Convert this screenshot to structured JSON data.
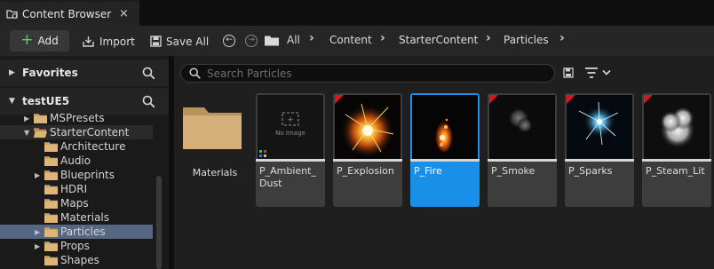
{
  "tab": {
    "title": "Content Browser",
    "close": "×"
  },
  "toolbar": {
    "add_label": "Add",
    "import_label": "Import",
    "saveall_label": "Save All",
    "breadcrumbs": [
      "All",
      "Content",
      "StarterContent",
      "Particles"
    ]
  },
  "sidebar": {
    "favorites_label": "Favorites",
    "project_label": "testUE5",
    "tree": [
      {
        "label": "MSPresets",
        "depth": 1,
        "expandable": true
      },
      {
        "label": "StarterContent",
        "depth": 1,
        "expanded": true
      },
      {
        "label": "Architecture",
        "depth": 2
      },
      {
        "label": "Audio",
        "depth": 2
      },
      {
        "label": "Blueprints",
        "depth": 2,
        "expandable": true
      },
      {
        "label": "HDRI",
        "depth": 2
      },
      {
        "label": "Maps",
        "depth": 2
      },
      {
        "label": "Materials",
        "depth": 2
      },
      {
        "label": "Particles",
        "depth": 2,
        "expandable": true,
        "selected": true
      },
      {
        "label": "Props",
        "depth": 2,
        "expandable": true
      },
      {
        "label": "Shapes",
        "depth": 2
      }
    ]
  },
  "search": {
    "placeholder": "Search Particles"
  },
  "assets": [
    {
      "label": "Materials",
      "type": "folder"
    },
    {
      "label": "P_Ambient_ Dust",
      "type": "noimage",
      "noimage_text": "No Image"
    },
    {
      "label": "P_Explosion",
      "type": "explosion"
    },
    {
      "label": "P_Fire",
      "type": "fire",
      "selected": true
    },
    {
      "label": "P_Smoke",
      "type": "smoke"
    },
    {
      "label": "P_Sparks",
      "type": "sparks"
    },
    {
      "label": "P_Steam_Lit",
      "type": "steam"
    }
  ],
  "colors": {
    "selection": "#1a8fe8",
    "tree_selection": "#556782",
    "folder": "#c8a46b",
    "marker": "#d8161d",
    "add_plus": "#6fc46a"
  }
}
